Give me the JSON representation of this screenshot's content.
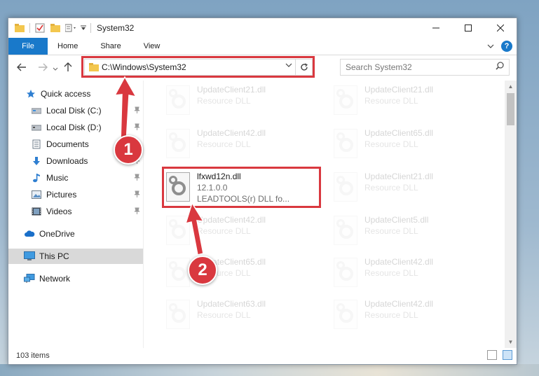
{
  "window": {
    "title": "System32"
  },
  "ribbon": {
    "tabs": [
      "File",
      "Home",
      "Share",
      "View"
    ]
  },
  "address": {
    "path": "C:\\Windows\\System32"
  },
  "search": {
    "placeholder": "Search System32"
  },
  "sidebar": {
    "items": [
      {
        "label": "Quick access",
        "icon": "star-icon",
        "pinned": false
      },
      {
        "label": "Local Disk (C:)",
        "icon": "drive-icon",
        "pinned": true
      },
      {
        "label": "Local Disk (D:)",
        "icon": "drive-icon",
        "pinned": true
      },
      {
        "label": "Documents",
        "icon": "document-icon",
        "pinned": true
      },
      {
        "label": "Downloads",
        "icon": "download-arrow-icon",
        "pinned": true
      },
      {
        "label": "Music",
        "icon": "music-note-icon",
        "pinned": true
      },
      {
        "label": "Pictures",
        "icon": "picture-icon",
        "pinned": true
      },
      {
        "label": "Videos",
        "icon": "film-icon",
        "pinned": true
      },
      {
        "label": "OneDrive",
        "icon": "cloud-icon",
        "pinned": false
      },
      {
        "label": "This PC",
        "icon": "computer-icon",
        "pinned": false,
        "selected": true
      },
      {
        "label": "Network",
        "icon": "network-icon",
        "pinned": false
      }
    ]
  },
  "files": {
    "left": [
      {
        "name": "UpdateClient21.dll",
        "type": "Resource DLL"
      },
      {
        "name": "UpdateClient42.dll",
        "type": "Resource DLL"
      },
      {
        "name": "lfxwd12n.dll",
        "version": "12.1.0.0",
        "desc": "LEADTOOLS(r) DLL fo..."
      },
      {
        "name": "UpdateClient42.dll",
        "type": "Resource DLL"
      },
      {
        "name": "UpdateClient65.dll",
        "type": "Resource DLL"
      },
      {
        "name": "UpdateClient63.dll",
        "type": "Resource DLL"
      }
    ],
    "right": [
      {
        "name": "UpdateClient21.dll",
        "type": "Resource DLL"
      },
      {
        "name": "UpdateClient65.dll",
        "type": "Resource DLL"
      },
      {
        "name": "UpdateClient21.dll",
        "type": "Resource DLL"
      },
      {
        "name": "UpdateClient5.dll",
        "type": "Resource DLL"
      },
      {
        "name": "UpdateClient42.dll",
        "type": "Resource DLL"
      },
      {
        "name": "UpdateClient42.dll",
        "type": "Resource DLL"
      }
    ]
  },
  "status": {
    "count": "103 items"
  },
  "annotations": {
    "step1": "1",
    "step2": "2",
    "color": "#d9383f"
  },
  "colors": {
    "accent": "#1979ca",
    "highlight": "#d9383f"
  }
}
